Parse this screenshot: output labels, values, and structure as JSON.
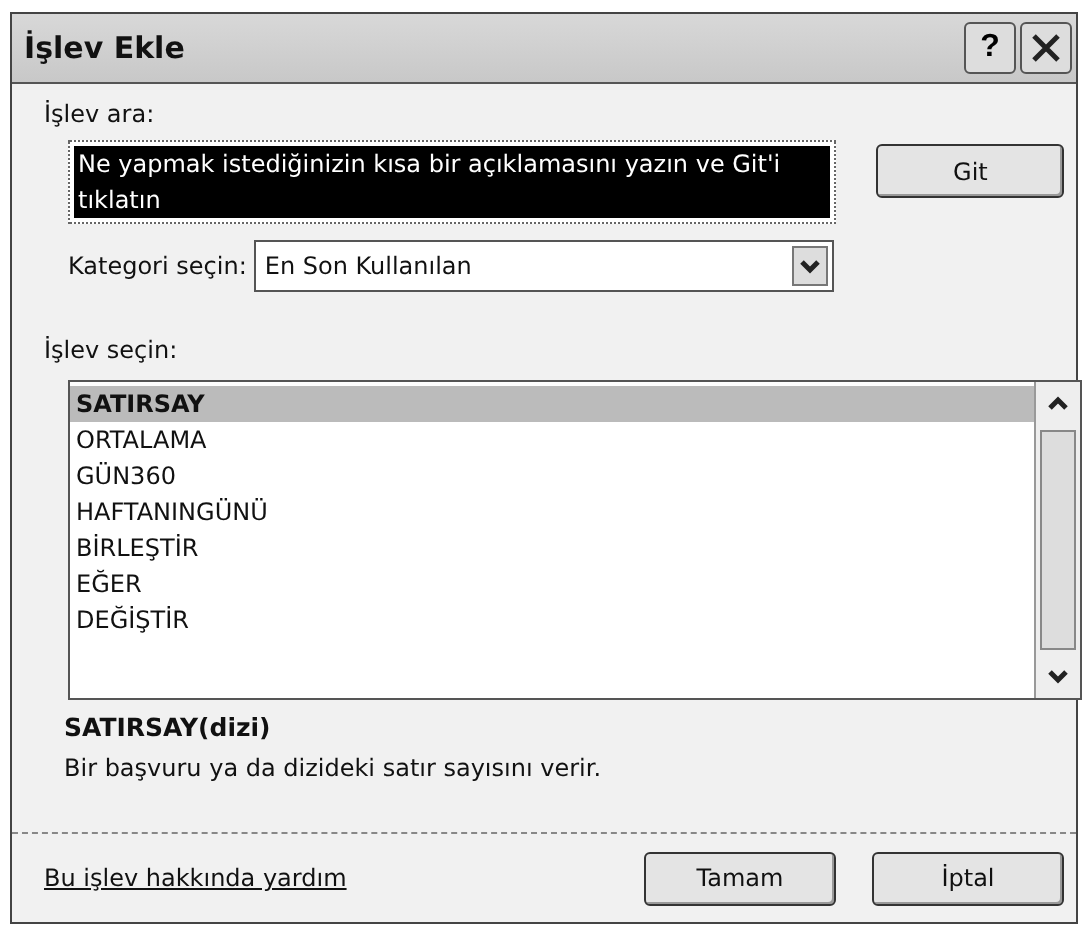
{
  "window": {
    "title": "İşlev Ekle",
    "help_button": "?"
  },
  "search": {
    "label": "İşlev ara:",
    "value": "Ne yapmak istediğinizin kısa bir açıklamasını yazın ve Git'i tıklatın",
    "text_selected": true
  },
  "go_button": "Git",
  "category": {
    "label": "Kategori seçin:",
    "value": "En Son Kullanılan"
  },
  "function_list": {
    "label": "İşlev seçin:",
    "items": [
      {
        "label": "SATIRSAY",
        "selected": true
      },
      {
        "label": "ORTALAMA",
        "selected": false
      },
      {
        "label": "GÜN360",
        "selected": false
      },
      {
        "label": "HAFTANINGÜNÜ",
        "selected": false
      },
      {
        "label": "BİRLEŞTİR",
        "selected": false
      },
      {
        "label": "EĞER",
        "selected": false
      },
      {
        "label": "DEĞİŞTİR",
        "selected": false
      }
    ]
  },
  "description": {
    "signature": "SATIRSAY(dizi)",
    "text": "Bir başvuru ya da dizideki satır sayısını verir."
  },
  "help_link": "Bu işlev hakkında yardım",
  "buttons": [
    "Tamam",
    "İptal"
  ]
}
